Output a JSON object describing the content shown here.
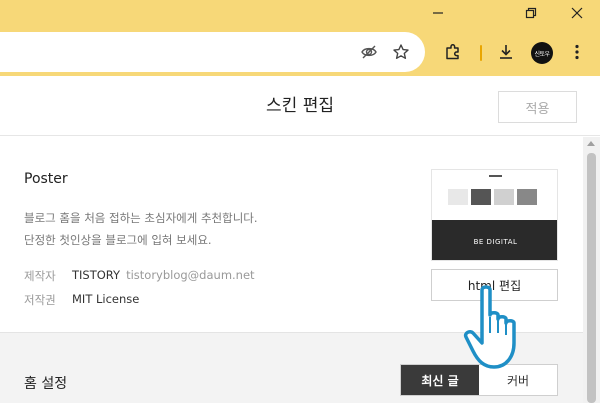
{
  "browser": {
    "icons": {
      "minimize": "minimize-icon",
      "restore": "restore-icon",
      "close": "close-icon",
      "eye_off": "eye-off-icon",
      "bookmark": "star-icon",
      "extensions": "puzzle-icon",
      "download": "download-icon",
      "menu": "kebab-menu-icon"
    },
    "profile_label": "신토우",
    "theme_color": "#f7d878"
  },
  "header": {
    "title": "스킨 편집",
    "apply_label": "적용"
  },
  "skin": {
    "name": "Poster",
    "description_line1": "블로그 홈을 처음 접하는 초심자에게 추천합니다.",
    "description_line2": "단정한 첫인상을 블로그에 입혀 보세요.",
    "maker_label": "제작자",
    "maker_value": "TISTORY",
    "maker_email": "tistoryblog@daum.net",
    "license_label": "저작권",
    "license_value": "MIT License",
    "thumbnail_text": "BE DIGITAL",
    "html_edit_label": "html 편집"
  },
  "home_settings": {
    "title": "홈 설정",
    "options": [
      "최신 글",
      "커버"
    ],
    "selected": "최신 글"
  }
}
